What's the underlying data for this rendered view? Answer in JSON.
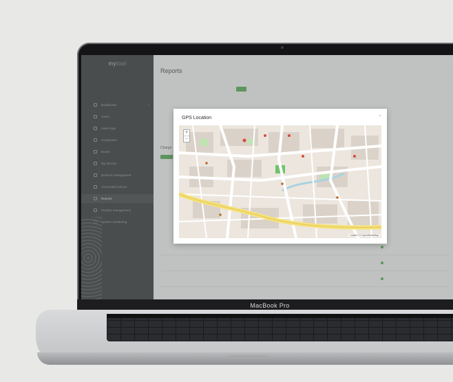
{
  "device": {
    "brand_label": "MacBook Pro"
  },
  "app": {
    "logo_main": "my",
    "logo_suffix": "tool"
  },
  "sidebar": {
    "items": [
      {
        "label": "Dashboard",
        "icon": "dashboard-icon",
        "has_chevron": true
      },
      {
        "label": "Users",
        "icon": "users-icon"
      },
      {
        "label": "Users logs",
        "icon": "logs-icon"
      },
      {
        "label": "Companies",
        "icon": "companies-icon"
      },
      {
        "label": "Boxes",
        "icon": "boxes-icon"
      },
      {
        "label": "My devices",
        "icon": "devices-icon"
      },
      {
        "label": "Devices management",
        "icon": "devices-management-icon"
      },
      {
        "label": "Associated actions",
        "icon": "actions-icon"
      },
      {
        "label": "Reports",
        "icon": "reports-icon",
        "active": true
      },
      {
        "label": "Product management",
        "icon": "product-icon"
      },
      {
        "label": "System monitoring",
        "icon": "monitoring-icon"
      }
    ]
  },
  "main": {
    "page_title": "Reports",
    "section_title": "Charge"
  },
  "modal": {
    "title": "GPS Location",
    "close_symbol": "×",
    "map": {
      "zoom_in": "+",
      "zoom_out": "−",
      "attribution": "Leaflet | © OpenStreetMap"
    }
  },
  "colors": {
    "accent_green": "#49a84b",
    "sidebar_bg": "#2a2b2e",
    "map_road_major": "#f6e27a",
    "map_park": "#6fc36a",
    "map_marker": "#d64a3a"
  }
}
